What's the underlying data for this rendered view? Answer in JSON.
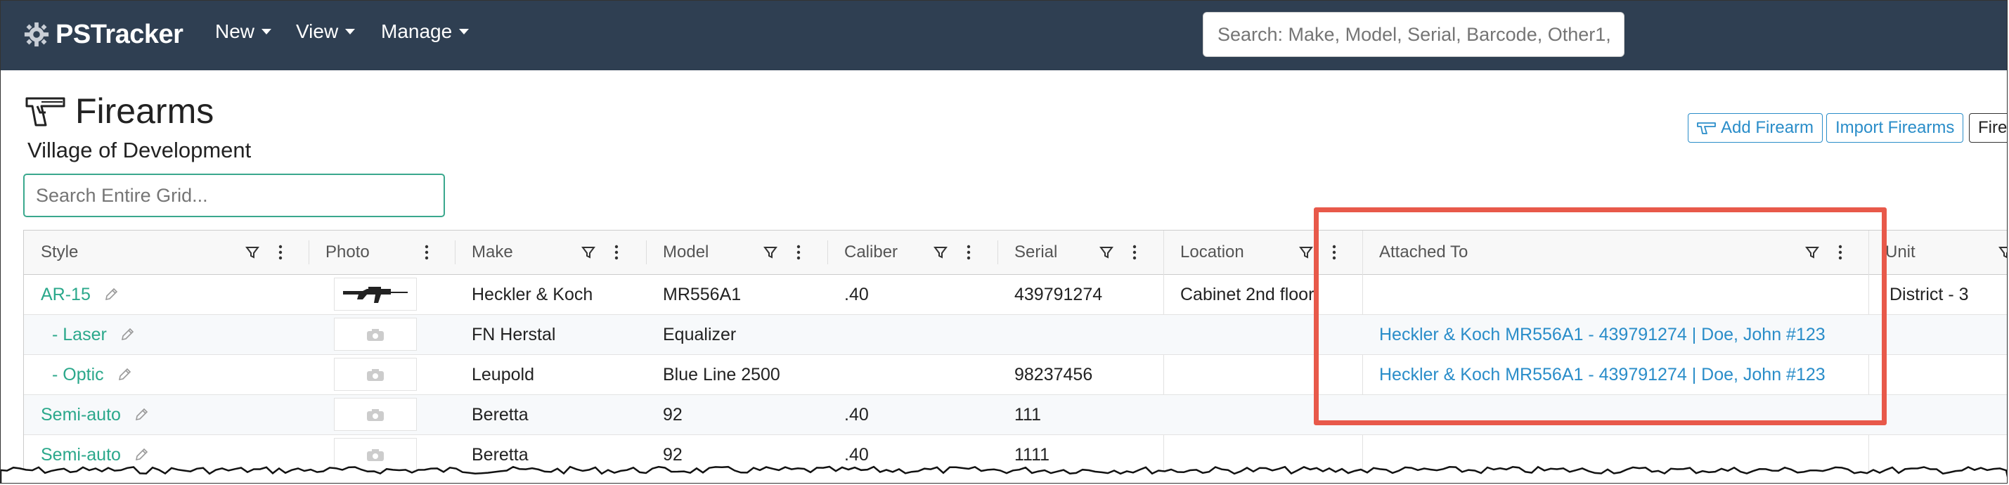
{
  "app": {
    "brand": "PSTracker"
  },
  "nav": {
    "new": "New",
    "view": "View",
    "manage": "Manage"
  },
  "global_search": {
    "placeholder": "Search: Make, Model, Serial, Barcode, Other1,"
  },
  "page": {
    "title": "Firearms",
    "subtitle": "Village of Development"
  },
  "grid_search": {
    "placeholder": "Search Entire Grid..."
  },
  "buttons": {
    "add": "Add Firearm",
    "import": "Import Firearms",
    "partial": "Fire"
  },
  "columns": {
    "style": "Style",
    "photo": "Photo",
    "make": "Make",
    "model": "Model",
    "caliber": "Caliber",
    "serial": "Serial",
    "location": "Location",
    "attached_to": "Attached To",
    "unit": "Unit"
  },
  "rows": [
    {
      "style": "AR-15",
      "make": "Heckler & Koch",
      "model": "MR556A1",
      "caliber": ".40",
      "serial": "439791274",
      "location": "Cabinet 2nd floor",
      "attached_to": "",
      "unit": "District - 3"
    },
    {
      "style": "- Laser",
      "make": "FN Herstal",
      "model": "Equalizer",
      "caliber": "",
      "serial": "",
      "location": "",
      "attached_to": "Heckler & Koch MR556A1 - 439791274 | Doe, John #123",
      "unit": ""
    },
    {
      "style": "- Optic",
      "make": "Leupold",
      "model": "Blue Line 2500",
      "caliber": "",
      "serial": "98237456",
      "location": "",
      "attached_to": "Heckler & Koch MR556A1 - 439791274 | Doe, John #123",
      "unit": ""
    },
    {
      "style": "Semi-auto",
      "make": "Beretta",
      "model": "92",
      "caliber": ".40",
      "serial": "111",
      "location": "",
      "attached_to": "",
      "unit": ""
    },
    {
      "style": "Semi-auto",
      "make": "Beretta",
      "model": "92",
      "caliber": ".40",
      "serial": "1111",
      "location": "",
      "attached_to": "",
      "unit": ""
    }
  ],
  "colors": {
    "nav_bg": "#2f3f52",
    "accent_green": "#2ba88b",
    "link_blue": "#2a8dc9",
    "highlight_red": "#e8594a"
  }
}
